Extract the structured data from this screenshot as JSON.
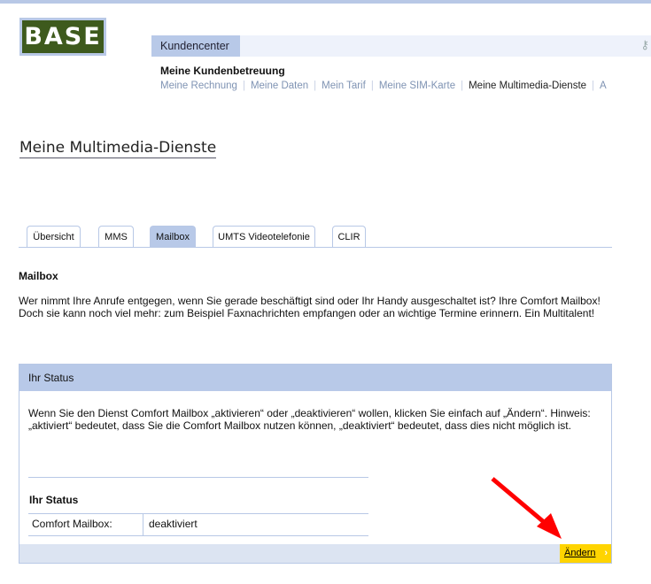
{
  "logo": "BASE",
  "header": {
    "section": "Kundencenter",
    "subtitle": "Meine Kundenbetreuung",
    "nav": [
      "Meine Rechnung",
      "Meine Daten",
      "Mein Tarif",
      "Meine SIM-Karte",
      "Meine Multimedia-Dienste",
      "A"
    ]
  },
  "page_title": "Meine Multimedia-Dienste",
  "tabs": [
    "Übersicht",
    "MMS",
    "Mailbox",
    "UMTS Videotelefonie",
    "CLIR"
  ],
  "active_tab": "Mailbox",
  "section": {
    "heading": "Mailbox",
    "text": "Wer nimmt Ihre Anrufe entgegen, wenn Sie gerade beschäftigt sind oder Ihr Handy ausgeschaltet ist? Ihre Comfort Mailbox! Doch sie kann noch viel mehr: zum Beispiel Faxnachrichten empfangen oder an wichtige Termine erinnern. Ein Multitalent!"
  },
  "status_box": {
    "header": "Ihr Status",
    "text": "Wenn Sie den Dienst Comfort Mailbox „aktivieren“ oder „deaktivieren“ wollen, klicken Sie einfach auf „Ändern“. Hinweis: „aktiviert“ bedeutet, dass Sie die Comfort Mailbox nutzen können, „deaktiviert“ bedeutet, dass dies nicht möglich ist.",
    "status_heading": "Ihr Status",
    "row_label": "Comfort Mailbox:",
    "row_value": "deaktiviert",
    "button": "Ändern",
    "button_chevron": "›"
  },
  "colors": {
    "accent": "#b8c9e8",
    "button": "#ffd400",
    "arrow": "#ff0000",
    "logo": "#3e5a1d"
  }
}
